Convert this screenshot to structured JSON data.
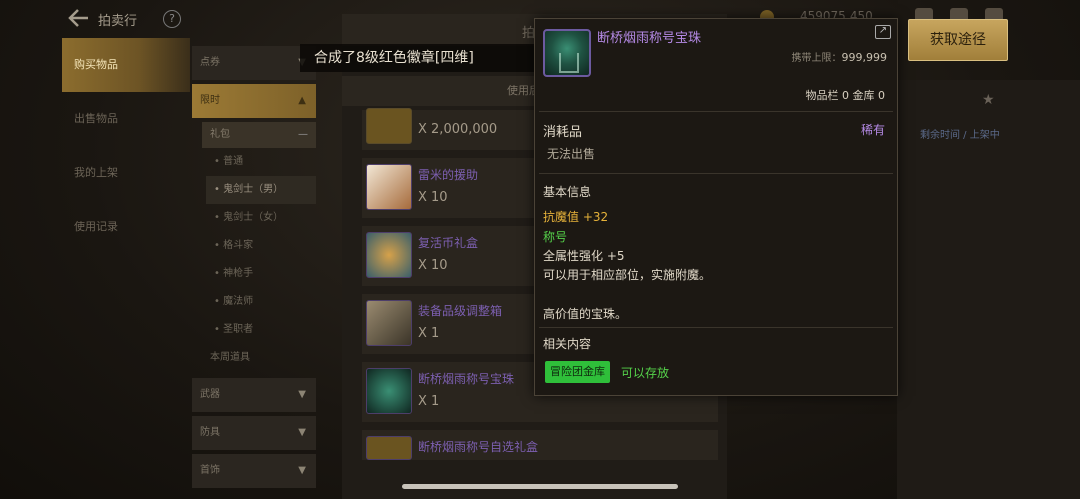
{
  "topbar": {
    "title": "拍卖行",
    "help": "?",
    "currency": "459075․450"
  },
  "leftnav": [
    {
      "label": "购买物品",
      "active": true
    },
    {
      "label": "出售物品",
      "active": false
    },
    {
      "label": "我的上架",
      "active": false
    },
    {
      "label": "使用记录",
      "active": false
    }
  ],
  "categories": {
    "top": "点券",
    "open": "限时",
    "sub": "礼包",
    "subitems": [
      "普通",
      "鬼剑士（男）",
      "鬼剑士（女）",
      "格斗家",
      "神枪手",
      "魔法师",
      "圣职者"
    ],
    "subplain": "本周道具",
    "bottom": [
      "武器",
      "防具",
      "首饰"
    ]
  },
  "center": {
    "tab": "拍",
    "use_after": "使用后获得",
    "items": [
      {
        "name": "",
        "qty": "X 2,000,000"
      },
      {
        "name": "雷米的援助",
        "qty": "X 10"
      },
      {
        "name": "复活币礼盒",
        "qty": "X 10"
      },
      {
        "name": "装备品级调整箱",
        "qty": "X 1"
      },
      {
        "name": "断桥烟雨称号宝珠",
        "qty": "X 1"
      },
      {
        "name": "断桥烟雨称号自选礼盒",
        "qty": ""
      }
    ]
  },
  "notify": "合成了8级红色徽章[四维]",
  "right": {
    "text": "剩余时间 / 上架中"
  },
  "tooltip": {
    "name": "断桥烟雨称号宝珠",
    "limit_label": "携带上限：",
    "limit_value": "999,999",
    "storage": "物品栏 0 金库 0",
    "type": "消耗品",
    "rarity": "稀有",
    "notrade": "无法出售",
    "basic": "基本信息",
    "lines": [
      {
        "text": "抗魔值 +32",
        "color": "#e6b23a"
      },
      {
        "text": "称号",
        "color": "#55d24a"
      },
      {
        "text": "全属性强化 +5",
        "color": "#e0d8c8"
      },
      {
        "text": "可以用于相应部位，实施附魔。",
        "color": "#e0d8c8"
      },
      {
        "text": "高价值的宝珠。",
        "color": "#e0d8c8"
      }
    ],
    "related": "相关内容",
    "badge": "冒险团金库",
    "can_store": "可以存放"
  },
  "get_button": "获取途径"
}
